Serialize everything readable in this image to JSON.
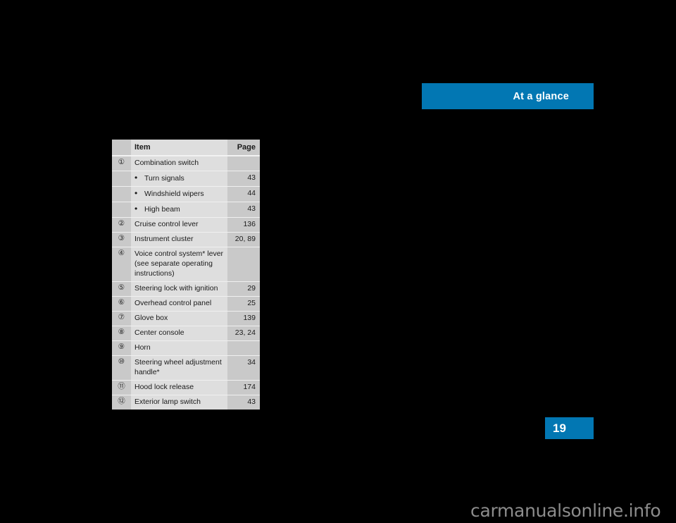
{
  "banner": {
    "title": "At a glance",
    "color": "#0277b3"
  },
  "page_tab": {
    "number": "19",
    "color": "#0277b3"
  },
  "watermark": {
    "text": "carmanualsonline.info"
  },
  "table": {
    "header": {
      "num": "",
      "item": "Item",
      "page": "Page"
    },
    "rows": [
      {
        "num": "①",
        "item": "Combination switch",
        "page": ""
      },
      {
        "num": "",
        "bullet": "•",
        "item": "Turn signals",
        "page": "43"
      },
      {
        "num": "",
        "bullet": "•",
        "item": "Windshield wipers",
        "page": "44"
      },
      {
        "num": "",
        "bullet": "•",
        "item": "High beam",
        "page": "43"
      },
      {
        "num": "②",
        "item": "Cruise control lever",
        "page": "136"
      },
      {
        "num": "③",
        "item": "Instrument cluster",
        "page": "20, 89"
      },
      {
        "num": "④",
        "item": "Voice control system* lever (see separate operating instructions)",
        "page": ""
      },
      {
        "num": "⑤",
        "item": "Steering lock with ignition",
        "page": "29"
      },
      {
        "num": "⑥",
        "item": "Overhead control panel",
        "page": "25"
      },
      {
        "num": "⑦",
        "item": "Glove box",
        "page": "139"
      },
      {
        "num": "⑧",
        "item": "Center console",
        "page": "23, 24"
      },
      {
        "num": "⑨",
        "item": "Horn",
        "page": ""
      },
      {
        "num": "⑩",
        "item": "Steering wheel adjustment handle*",
        "page": "34"
      },
      {
        "num": "⑪",
        "item": "Hood lock release",
        "page": "174"
      },
      {
        "num": "⑫",
        "item": "Exterior lamp switch",
        "page": "43"
      }
    ]
  }
}
